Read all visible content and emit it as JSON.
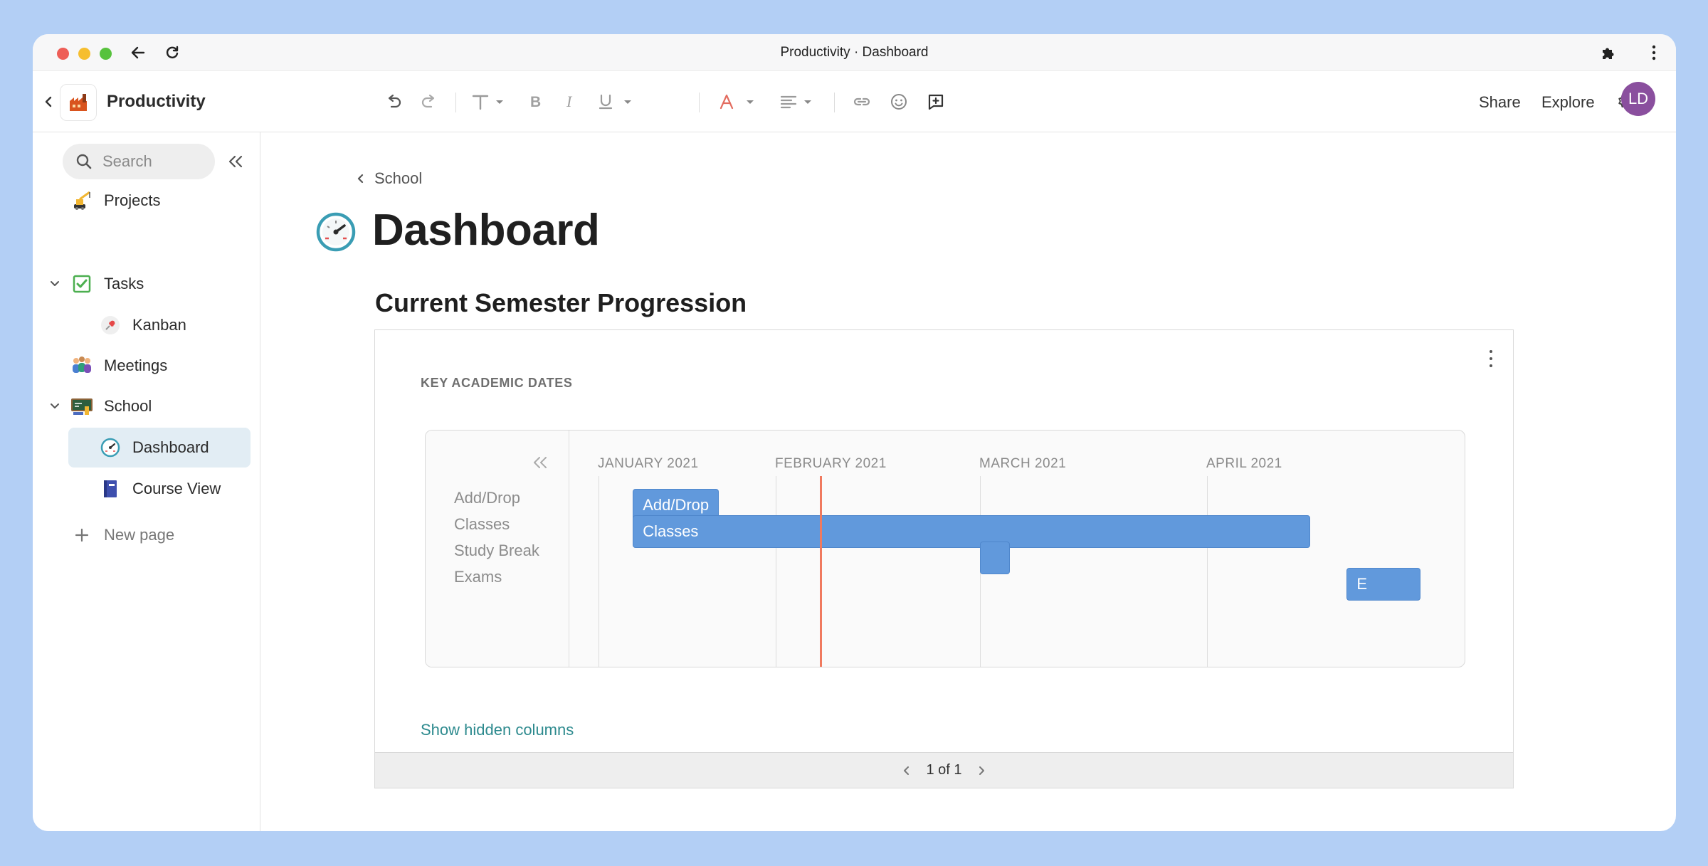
{
  "browser": {
    "title": "Productivity · Dashboard"
  },
  "app": {
    "name": "Productivity",
    "share_label": "Share",
    "explore_label": "Explore",
    "avatar_initials": "LD",
    "avatar_color": "#8a4f9e"
  },
  "sidebar": {
    "search_placeholder": "Search",
    "items": [
      {
        "label": "Projects",
        "icon": "crane-icon"
      },
      {
        "label": "Tasks",
        "icon": "checkbox-icon"
      },
      {
        "label": "Kanban",
        "icon": "pushpin-icon"
      },
      {
        "label": "Meetings",
        "icon": "people-icon"
      },
      {
        "label": "School",
        "icon": "school-icon"
      },
      {
        "label": "Dashboard",
        "icon": "speedometer-icon"
      },
      {
        "label": "Course View",
        "icon": "notebook-icon"
      }
    ],
    "new_page_label": "New page"
  },
  "main": {
    "breadcrumb": "School",
    "page_title": "Dashboard",
    "section_title": "Current Semester Progression",
    "card_label": "KEY ACADEMIC DATES",
    "show_hidden_label": "Show hidden columns",
    "pager_text": "1 of 1"
  },
  "chart_data": {
    "type": "gantt",
    "months": [
      "JANUARY 2021",
      "FEBRUARY 2021",
      "MARCH 2021",
      "APRIL 2021"
    ],
    "rows": [
      {
        "label": "Add/Drop",
        "bar_label": "Add/Drop",
        "start": "2021-01-07",
        "end": "2021-01-22"
      },
      {
        "label": "Classes",
        "bar_label": "Classes",
        "start": "2021-01-07",
        "end": "2021-04-15"
      },
      {
        "label": "Study Break",
        "bar_label": "",
        "start": "2021-03-01",
        "end": "2021-03-05"
      },
      {
        "label": "Exams",
        "bar_label": "E",
        "start": "2021-04-20",
        "end": "2021-04-30"
      }
    ],
    "today": "2021-02-07",
    "bar_color": "#6199dc",
    "today_color": "#f07a5f"
  }
}
